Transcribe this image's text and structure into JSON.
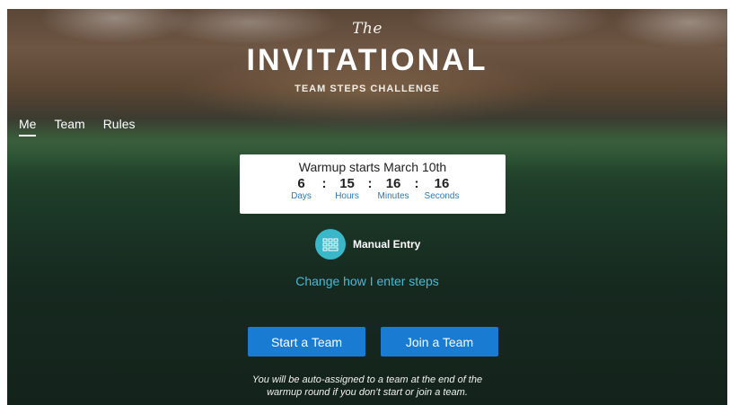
{
  "header": {
    "logo_the": "The",
    "logo_main": "INVITATIONAL",
    "logo_sub": "TEAM STEPS CHALLENGE"
  },
  "nav": {
    "items": [
      {
        "label": "Me",
        "active": true
      },
      {
        "label": "Team",
        "active": false
      },
      {
        "label": "Rules",
        "active": false
      }
    ]
  },
  "countdown": {
    "title": "Warmup starts March 10th",
    "days": {
      "value": "6",
      "label": "Days"
    },
    "hours": {
      "value": "15",
      "label": "Hours"
    },
    "minutes": {
      "value": "16",
      "label": "Minutes"
    },
    "seconds": {
      "value": "16",
      "label": "Seconds"
    },
    "separator": ":"
  },
  "entry": {
    "icon": "keypad-icon",
    "label": "Manual Entry",
    "change_link": "Change how I enter steps"
  },
  "actions": {
    "start_label": "Start a Team",
    "join_label": "Join a Team"
  },
  "note": {
    "line1": "You will be auto-assigned to a team at the end of the",
    "line2": "warmup round if you don’t start or join a team."
  },
  "colors": {
    "accent": "#1a7bd3",
    "link": "#4ab8d8",
    "icon_bg": "#3ab7c9",
    "countdown_label": "#2a7ab8"
  }
}
